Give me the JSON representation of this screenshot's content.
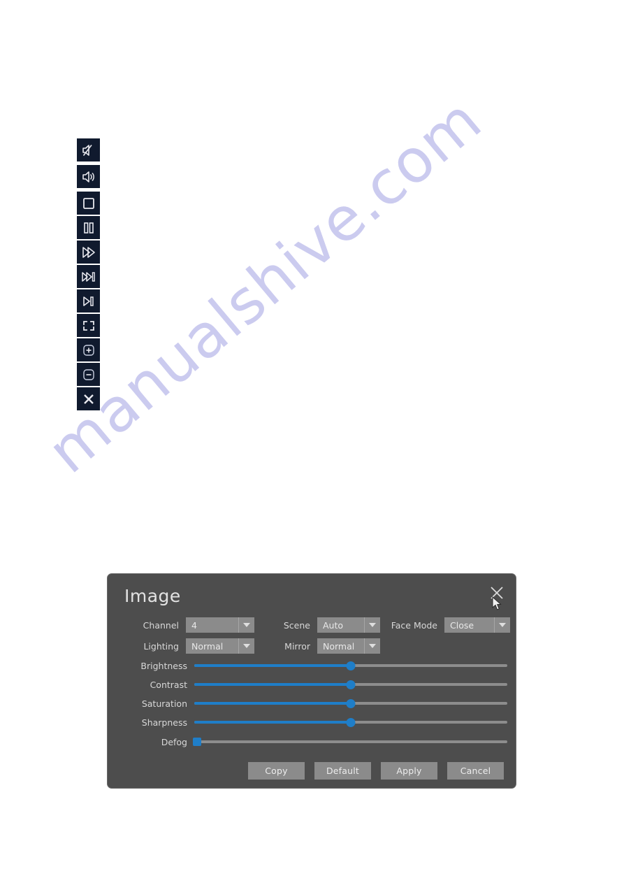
{
  "watermark": {
    "text": "manualshive.com",
    "color": "#c9c9ef"
  },
  "toolbar": {
    "name": "playback-toolbar",
    "icons": [
      {
        "name": "mute-icon",
        "label": "Mute"
      },
      {
        "name": "volume-icon",
        "label": "Volume"
      },
      {
        "name": "stop-icon",
        "label": "Stop"
      },
      {
        "name": "pause-icon",
        "label": "Pause"
      },
      {
        "name": "fast-forward-icon",
        "label": "Fast Forward"
      },
      {
        "name": "next-file-icon",
        "label": "Next File"
      },
      {
        "name": "next-frame-icon",
        "label": "Next Frame"
      },
      {
        "name": "full-screen-icon",
        "label": "Full Screen"
      },
      {
        "name": "zoom-in-icon",
        "label": "Zoom In"
      },
      {
        "name": "zoom-out-icon",
        "label": "Zoom Out"
      },
      {
        "name": "exit-icon",
        "label": "Exit"
      }
    ]
  },
  "dialog": {
    "title": "Image",
    "close_label": "×",
    "fields": [
      {
        "name": "channel",
        "label": "Channel",
        "value": "4"
      },
      {
        "name": "scene",
        "label": "Scene",
        "value": "Auto"
      },
      {
        "name": "face-mode",
        "label": "Face Mode",
        "value": "Close"
      },
      {
        "name": "lighting",
        "label": "Lighting",
        "value": "Normal"
      },
      {
        "name": "mirror",
        "label": "Mirror",
        "value": "Normal"
      }
    ],
    "sliders": [
      {
        "name": "brightness",
        "label": "Brightness",
        "value": 50
      },
      {
        "name": "contrast",
        "label": "Contrast",
        "value": 50
      },
      {
        "name": "saturation",
        "label": "Saturation",
        "value": 50
      },
      {
        "name": "sharpness",
        "label": "Sharpness",
        "value": 50
      },
      {
        "name": "defog",
        "label": "Defog",
        "value": 0
      }
    ],
    "buttons": [
      {
        "name": "copy-button",
        "label": "Copy"
      },
      {
        "name": "default-button",
        "label": "Default"
      },
      {
        "name": "apply-button",
        "label": "Apply"
      },
      {
        "name": "cancel-button",
        "label": "Cancel"
      }
    ],
    "colors": {
      "panel": "#4d4d4d",
      "control": "#8b8b8b",
      "slider_active": "#1f7ec8",
      "slider_track": "#8d8d8d",
      "text": "#d8d8d8"
    }
  }
}
